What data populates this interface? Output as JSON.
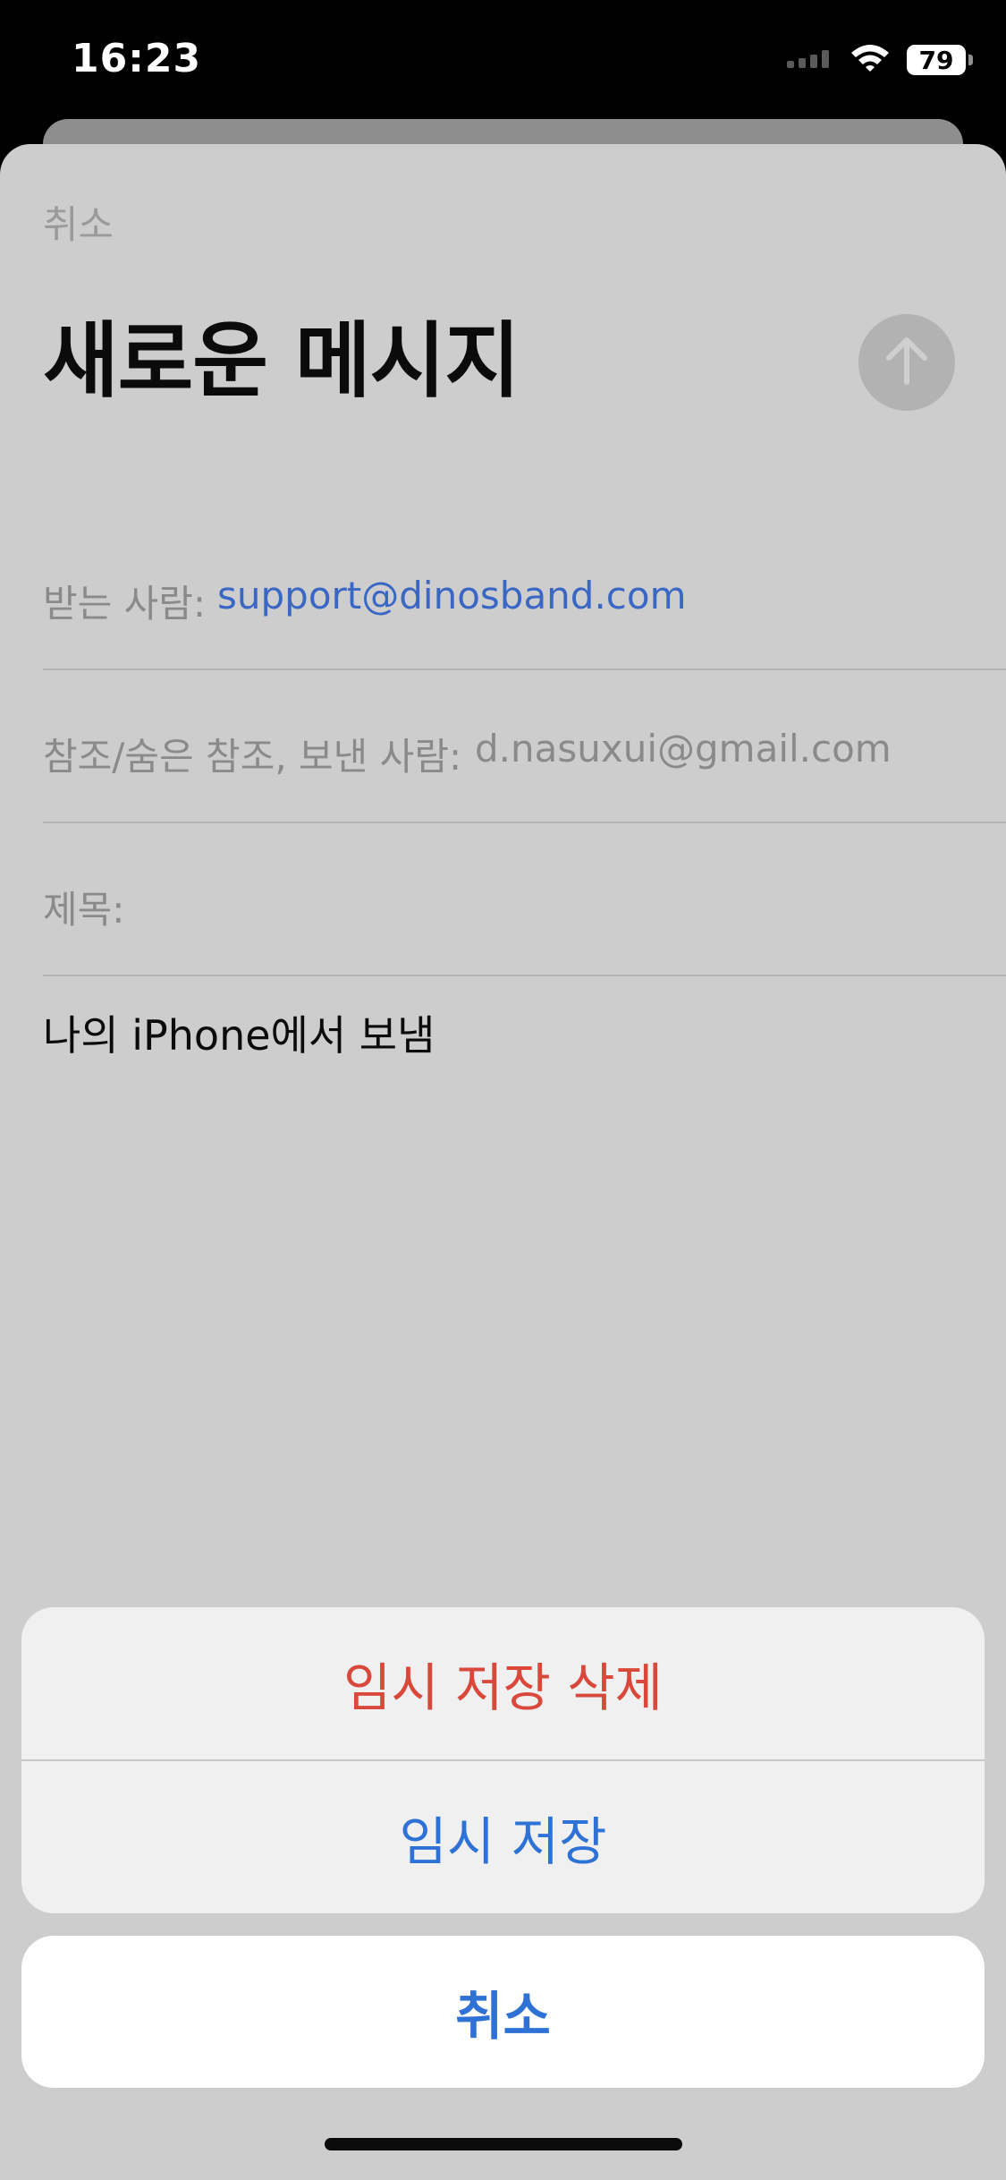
{
  "status_bar": {
    "time": "16:23",
    "battery_level": "79",
    "icons": [
      "cellular-signal-icon",
      "wifi-icon",
      "battery-icon"
    ]
  },
  "compose": {
    "cancel_label": "취소",
    "title": "새로운 메시지",
    "send_icon": "arrow-up-icon",
    "to_label": "받는 사람:",
    "to_value": "support@dinosband.com",
    "cc_label": "참조/숨은 참조, 보낸 사람:",
    "cc_value": "d.nasuxui@gmail.com",
    "subject_label": "제목:",
    "subject_value": "",
    "body_signature": "나의 iPhone에서 보냄"
  },
  "action_sheet": {
    "delete_draft_label": "임시 저장 삭제",
    "save_draft_label": "임시 저장",
    "cancel_label": "취소"
  },
  "colors": {
    "destructive": "#d9483b",
    "accent": "#2f72d6",
    "link": "#3a66c4"
  }
}
